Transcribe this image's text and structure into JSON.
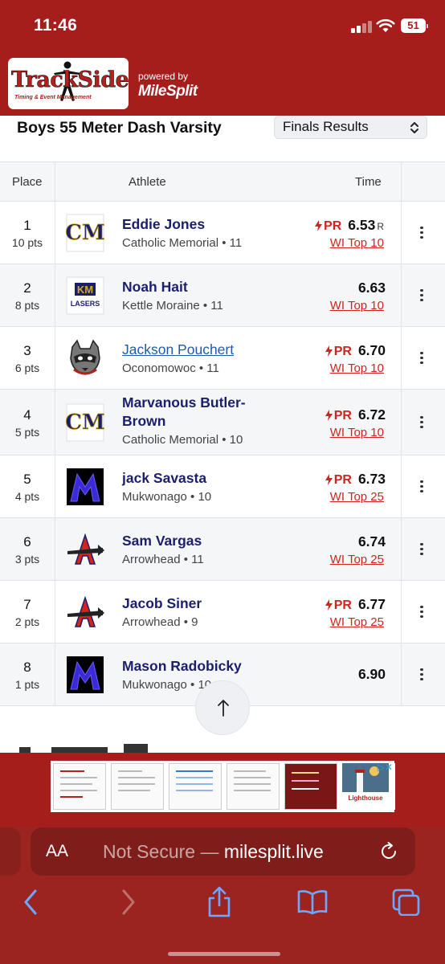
{
  "status_bar": {
    "time": "11:46",
    "battery": "51"
  },
  "header": {
    "logo_main": "TrackSide",
    "logo_sub": "Timing & Event Management",
    "powered_by": "powered by",
    "brand": "MileSplit"
  },
  "event": {
    "title": "Boys 55 Meter Dash Varsity",
    "round_selected": "Finals Results"
  },
  "table": {
    "headers": {
      "place": "Place",
      "athlete": "Athlete",
      "time": "Time"
    },
    "rows": [
      {
        "place": "1",
        "pts": "10 pts",
        "name": "Eddie Jones",
        "meta": "Catholic Memorial • 11",
        "pr": "PR",
        "time": "6.53",
        "suffix": "R",
        "rank": "WI Top 10",
        "logo": "cm"
      },
      {
        "place": "2",
        "pts": "8 pts",
        "name": "Noah Hait",
        "meta": "Kettle Moraine • 11",
        "pr": "",
        "time": "6.63",
        "suffix": "",
        "rank": "WI Top 10",
        "logo": "km"
      },
      {
        "place": "3",
        "pts": "6 pts",
        "name": "Jackson Pouchert",
        "meta": "Oconomowoc • 11",
        "pr": "PR",
        "time": "6.70",
        "suffix": "",
        "rank": "WI Top 10",
        "logo": "raccoon"
      },
      {
        "place": "4",
        "pts": "5 pts",
        "name": "Marvanous Butler-Brown",
        "meta": "Catholic Memorial • 10",
        "pr": "PR",
        "time": "6.72",
        "suffix": "",
        "rank": "WI Top 10",
        "logo": "cm"
      },
      {
        "place": "5",
        "pts": "4 pts",
        "name": "jack Savasta",
        "meta": "Mukwonago • 10",
        "pr": "PR",
        "time": "6.73",
        "suffix": "",
        "rank": "WI Top 25",
        "logo": "m"
      },
      {
        "place": "6",
        "pts": "3 pts",
        "name": "Sam Vargas",
        "meta": "Arrowhead • 11",
        "pr": "",
        "time": "6.74",
        "suffix": "",
        "rank": "WI Top 25",
        "logo": "a"
      },
      {
        "place": "7",
        "pts": "2 pts",
        "name": "Jacob Siner",
        "meta": "Arrowhead • 9",
        "pr": "PR",
        "time": "6.77",
        "suffix": "",
        "rank": "WI Top 25",
        "logo": "a"
      },
      {
        "place": "8",
        "pts": "1 pts",
        "name": "Mason Radobicky",
        "meta": "Mukwonago • 10",
        "pr": "",
        "time": "6.90",
        "suffix": "",
        "rank": "",
        "logo": "m"
      }
    ]
  },
  "ad": {
    "badge": "▷✕",
    "brand": "Lighthouse"
  },
  "browser": {
    "aa": "AA",
    "security": "Not Secure — ",
    "domain": "milesplit.live"
  },
  "colors": {
    "brand_red": "#a51e1c",
    "name_navy": "#1b1f6b",
    "pr_red": "#d3231f",
    "link_blue": "#1e5aa8"
  },
  "icons": [
    "signal-icon",
    "wifi-icon",
    "battery-icon",
    "select-chevron-icon",
    "pr-bolt-icon",
    "kebab-menu-icon",
    "arrow-up-icon",
    "reload-icon",
    "back-icon",
    "forward-icon",
    "share-icon",
    "bookmarks-icon",
    "tabs-icon"
  ]
}
